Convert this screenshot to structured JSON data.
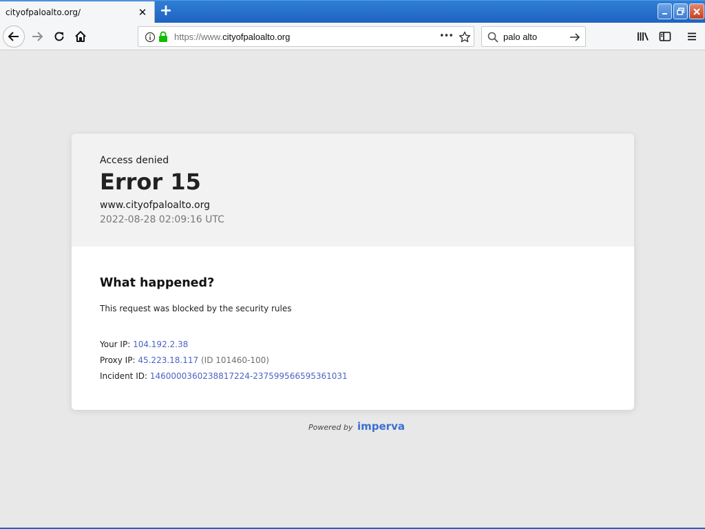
{
  "browser": {
    "tab_title": "cityofpaloalto.org/",
    "tab_close": "✕",
    "new_tab": "+",
    "url_scheme": "https://www.",
    "url_host": "cityofpaloalto.org",
    "search_value": "palo alto",
    "page_actions": "•••"
  },
  "page": {
    "access_label": "Access denied",
    "error_title": "Error 15",
    "domain": "www.cityofpaloalto.org",
    "timestamp": "2022-08-28 02:09:16 UTC",
    "what_happened": "What happened?",
    "blocked_message": "This request was blocked by the security rules",
    "your_ip_label": "Your IP:",
    "your_ip": "104.192.2.38",
    "proxy_ip_label": "Proxy IP:",
    "proxy_ip": "45.223.18.117",
    "proxy_id": "(ID 101460-100)",
    "incident_label": "Incident ID:",
    "incident_id": "1460000360238817224-237599566595361031",
    "powered_by": "Powered by",
    "brand": "imperva"
  },
  "colors": {
    "title_bar": "#1e63c1",
    "link": "#4a63c5",
    "brand": "#3a6fd0",
    "lock": "#12bc00"
  }
}
